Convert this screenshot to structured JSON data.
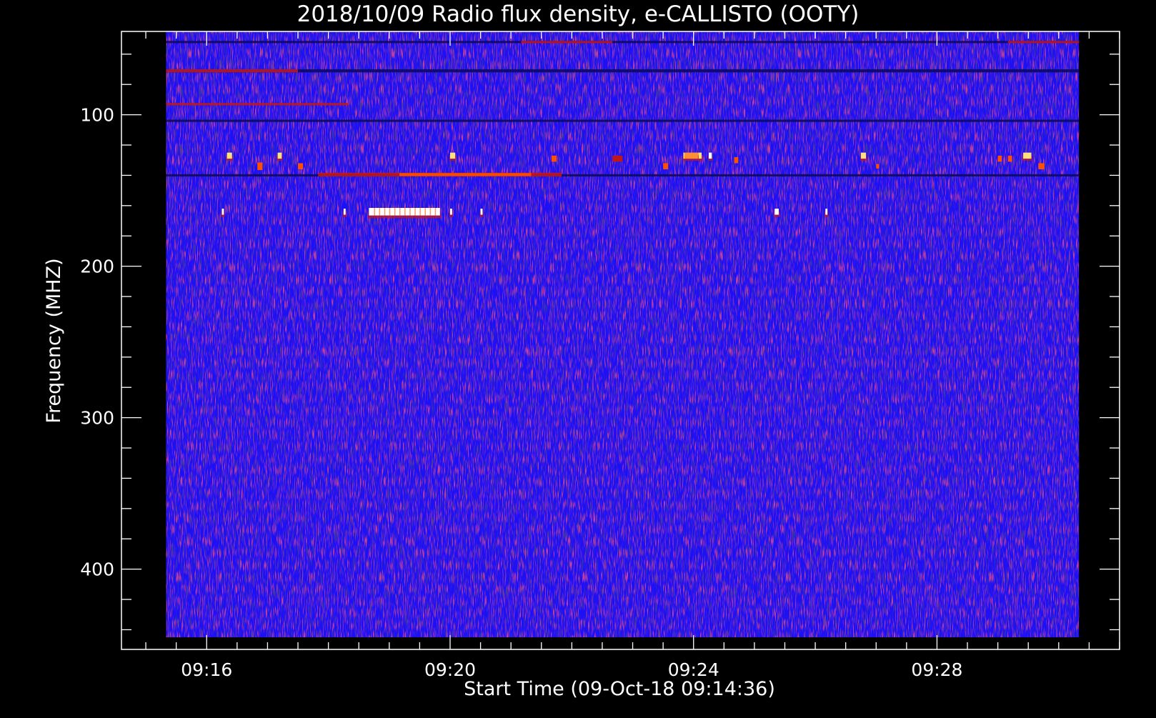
{
  "chart_data": {
    "type": "heatmap",
    "title": "2018/10/09  Radio flux density, e-CALLISTO (OOTY)",
    "xlabel": "Start Time (09-Oct-18 09:14:36)",
    "ylabel": "Frequency (MHZ)",
    "x_axis": {
      "type": "time",
      "range": [
        "09:14:36",
        "09:31:00"
      ],
      "data_range": [
        "09:15:20",
        "09:30:20"
      ],
      "major_ticks": [
        "09:16",
        "09:20",
        "09:24",
        "09:28"
      ],
      "minor_tick_interval_seconds": 30
    },
    "y_axis": {
      "range": [
        45,
        453
      ],
      "inverted": true,
      "data_range": [
        45,
        445
      ],
      "major_ticks": [
        100,
        200,
        300,
        400
      ],
      "minor_tick_interval": 20
    },
    "colors": {
      "background_frame": "#000000",
      "base_field": "#1e10f5",
      "dark_band": "#0a0a55",
      "moderate": "#c01818",
      "strong": "#ff5000",
      "peak": "#ffe080",
      "saturated": "#ffffff",
      "axis": "#ffffff"
    },
    "horizontal_bands": [
      {
        "freq_mhz": 52,
        "start": "09:15:20",
        "end": "09:30:20",
        "kind": "dark",
        "thickness_mhz": 1.5
      },
      {
        "freq_mhz": 52,
        "start": "09:21:10",
        "end": "09:22:40",
        "kind": "moderate",
        "thickness_mhz": 1.5
      },
      {
        "freq_mhz": 52,
        "start": "09:29:10",
        "end": "09:30:20",
        "kind": "moderate",
        "thickness_mhz": 1.5
      },
      {
        "freq_mhz": 71,
        "start": "09:15:20",
        "end": "09:30:20",
        "kind": "dark",
        "thickness_mhz": 2
      },
      {
        "freq_mhz": 71,
        "start": "09:15:20",
        "end": "09:17:30",
        "kind": "moderate",
        "thickness_mhz": 2
      },
      {
        "freq_mhz": 93,
        "start": "09:15:20",
        "end": "09:18:20",
        "kind": "moderate",
        "thickness_mhz": 1.5
      },
      {
        "freq_mhz": 104,
        "start": "09:15:20",
        "end": "09:30:20",
        "kind": "dark",
        "thickness_mhz": 1.5
      },
      {
        "freq_mhz": 140,
        "start": "09:15:20",
        "end": "09:30:20",
        "kind": "dark",
        "thickness_mhz": 1.5
      },
      {
        "freq_mhz": 139.5,
        "start": "09:17:50",
        "end": "09:21:50",
        "kind": "moderate",
        "thickness_mhz": 2.5
      },
      {
        "freq_mhz": 139.5,
        "start": "09:19:10",
        "end": "09:21:20",
        "kind": "strong",
        "thickness_mhz": 2
      }
    ],
    "bursts": [
      {
        "time": "09:16:20",
        "freq_mhz": 127,
        "width_s": 5,
        "height_mhz": 4,
        "intensity": "peak"
      },
      {
        "time": "09:16:50",
        "freq_mhz": 134,
        "width_s": 5,
        "height_mhz": 5,
        "intensity": "strong"
      },
      {
        "time": "09:17:10",
        "freq_mhz": 127,
        "width_s": 4,
        "height_mhz": 4,
        "intensity": "peak"
      },
      {
        "time": "09:17:30",
        "freq_mhz": 134,
        "width_s": 5,
        "height_mhz": 4,
        "intensity": "strong"
      },
      {
        "time": "09:20:00",
        "freq_mhz": 127,
        "width_s": 5,
        "height_mhz": 4,
        "intensity": "peak"
      },
      {
        "time": "09:21:40",
        "freq_mhz": 129,
        "width_s": 5,
        "height_mhz": 4,
        "intensity": "strong"
      },
      {
        "time": "09:22:40",
        "freq_mhz": 129,
        "width_s": 10,
        "height_mhz": 4,
        "intensity": "moderate"
      },
      {
        "time": "09:23:30",
        "freq_mhz": 134,
        "width_s": 5,
        "height_mhz": 4,
        "intensity": "strong"
      },
      {
        "time": "09:23:50",
        "freq_mhz": 127,
        "width_s": 15,
        "height_mhz": 4,
        "intensity": "peak"
      },
      {
        "time": "09:24:05",
        "freq_mhz": 127,
        "width_s": 3,
        "height_mhz": 4,
        "intensity": "peak"
      },
      {
        "time": "09:24:15",
        "freq_mhz": 127,
        "width_s": 3,
        "height_mhz": 4,
        "intensity": "saturated"
      },
      {
        "time": "09:24:40",
        "freq_mhz": 130,
        "width_s": 4,
        "height_mhz": 4,
        "intensity": "strong"
      },
      {
        "time": "09:26:45",
        "freq_mhz": 127,
        "width_s": 5,
        "height_mhz": 4,
        "intensity": "peak"
      },
      {
        "time": "09:27:00",
        "freq_mhz": 134,
        "width_s": 3,
        "height_mhz": 3,
        "intensity": "strong"
      },
      {
        "time": "09:29:00",
        "freq_mhz": 129,
        "width_s": 4,
        "height_mhz": 4,
        "intensity": "strong"
      },
      {
        "time": "09:29:10",
        "freq_mhz": 129,
        "width_s": 4,
        "height_mhz": 4,
        "intensity": "strong"
      },
      {
        "time": "09:29:25",
        "freq_mhz": 127,
        "width_s": 8,
        "height_mhz": 4,
        "intensity": "peak"
      },
      {
        "time": "09:29:40",
        "freq_mhz": 134,
        "width_s": 6,
        "height_mhz": 4,
        "intensity": "strong"
      },
      {
        "time": "09:16:15",
        "freq_mhz": 164,
        "width_s": 2,
        "height_mhz": 4,
        "intensity": "saturated"
      },
      {
        "time": "09:18:15",
        "freq_mhz": 164,
        "width_s": 2,
        "height_mhz": 4,
        "intensity": "saturated"
      },
      {
        "time": "09:18:40",
        "freq_mhz": 164,
        "width_s": 70,
        "height_mhz": 5,
        "intensity": "saturated"
      },
      {
        "time": "09:20:00",
        "freq_mhz": 164,
        "width_s": 2,
        "height_mhz": 4,
        "intensity": "saturated"
      },
      {
        "time": "09:20:30",
        "freq_mhz": 164,
        "width_s": 2,
        "height_mhz": 4,
        "intensity": "saturated"
      },
      {
        "time": "09:25:20",
        "freq_mhz": 164,
        "width_s": 4,
        "height_mhz": 4,
        "intensity": "saturated"
      },
      {
        "time": "09:26:10",
        "freq_mhz": 164,
        "width_s": 2,
        "height_mhz": 4,
        "intensity": "saturated"
      }
    ]
  }
}
